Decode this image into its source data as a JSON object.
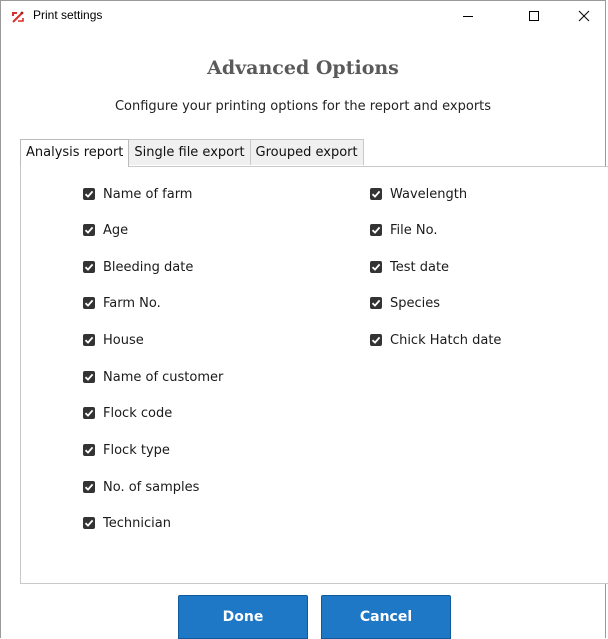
{
  "window": {
    "title": "Print settings",
    "controls": {
      "minimize": "—",
      "maximize": "☐",
      "close": "✕"
    }
  },
  "header": {
    "title": "Advanced Options",
    "subtitle": "Configure your printing options for the report and exports"
  },
  "tabs": [
    {
      "label": "Analysis report",
      "active": true
    },
    {
      "label": "Single file export",
      "active": false
    },
    {
      "label": "Grouped export",
      "active": false
    }
  ],
  "options": {
    "left": [
      {
        "label": "Name of farm",
        "checked": true
      },
      {
        "label": "Age",
        "checked": true
      },
      {
        "label": "Bleeding date",
        "checked": true
      },
      {
        "label": "Farm No.",
        "checked": true
      },
      {
        "label": "House",
        "checked": true
      },
      {
        "label": "Name of customer",
        "checked": true
      },
      {
        "label": "Flock code",
        "checked": true
      },
      {
        "label": "Flock type",
        "checked": true
      },
      {
        "label": "No. of samples",
        "checked": true
      },
      {
        "label": "Technician",
        "checked": true
      }
    ],
    "right": [
      {
        "label": "Wavelength",
        "checked": true
      },
      {
        "label": "File No.",
        "checked": true
      },
      {
        "label": "Test date",
        "checked": true
      },
      {
        "label": "Species",
        "checked": true
      },
      {
        "label": "Chick Hatch date",
        "checked": true
      }
    ]
  },
  "buttons": {
    "done": "Done",
    "cancel": "Cancel"
  },
  "colors": {
    "button_bg": "#1f78c6",
    "heading": "#5a5a5a",
    "checkbox": "#333333"
  }
}
